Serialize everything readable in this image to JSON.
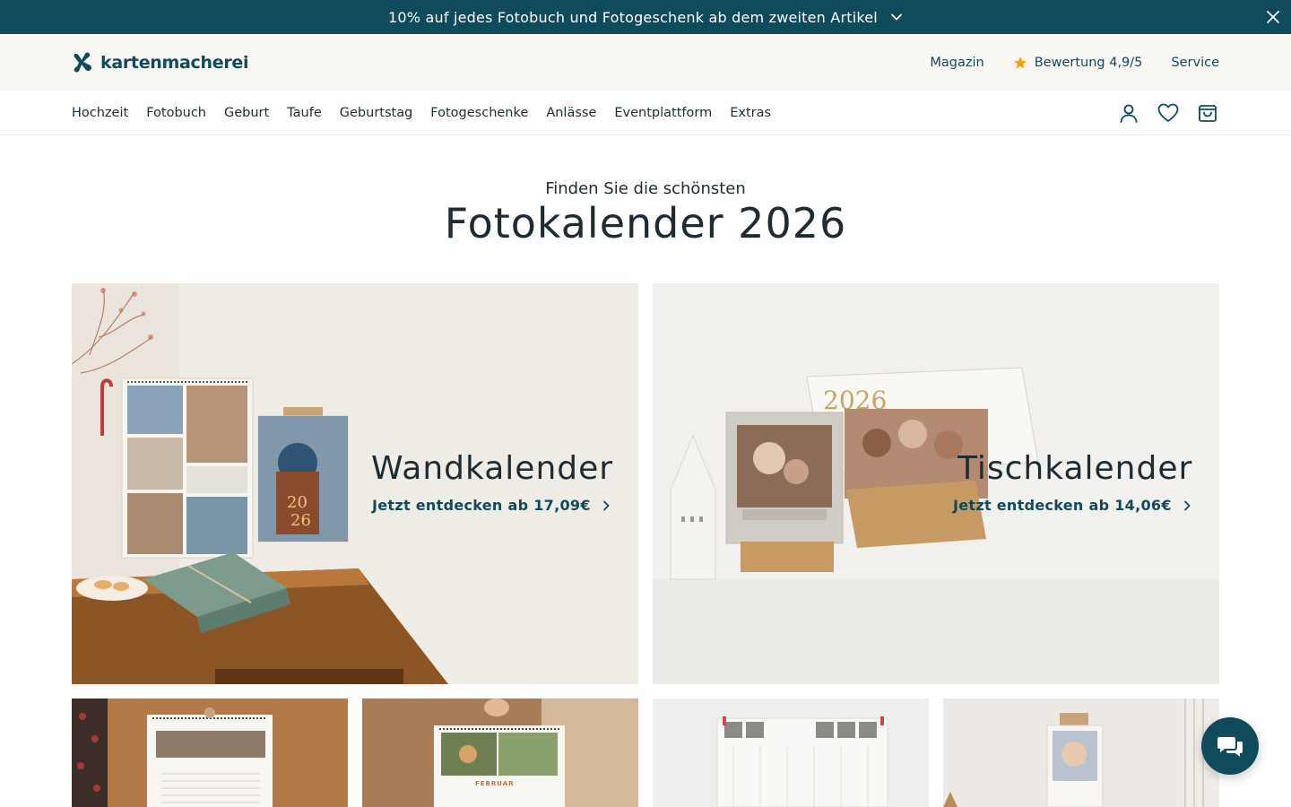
{
  "promo": {
    "text": "10% auf jedes Fotobuch und Fotogeschenk ab dem zweiten Artikel",
    "chevron_icon": "chevron-down-icon",
    "close_icon": "close-icon"
  },
  "header": {
    "logo_text": "kartenmacherei",
    "links": {
      "magazine": "Magazin",
      "rating": "Bewertung 4,9/5",
      "service": "Service"
    },
    "rating_icon": "star-icon"
  },
  "nav": {
    "items": [
      "Hochzeit",
      "Fotobuch",
      "Geburt",
      "Taufe",
      "Geburtstag",
      "Fotogeschenke",
      "Anlässe",
      "Eventplattform",
      "Extras"
    ],
    "icons": [
      "user-icon",
      "heart-icon",
      "shopping-bag-icon"
    ]
  },
  "page": {
    "kicker": "Finden Sie die schönsten",
    "title": "Fotokalender 2026"
  },
  "heroes": [
    {
      "title": "Wandkalender",
      "cta": "Jetzt entdecken ab 17,09€"
    },
    {
      "title": "Tischkalender",
      "cta": "Jetzt entdecken ab 14,06€"
    }
  ],
  "thumbnails": {
    "labels": [
      "FEBRUAR"
    ]
  },
  "chat": {
    "icon": "chat-icon"
  },
  "colors": {
    "brand": "#0f4b5a",
    "text": "#1d2b33",
    "accent_star": "#f2a20c"
  }
}
